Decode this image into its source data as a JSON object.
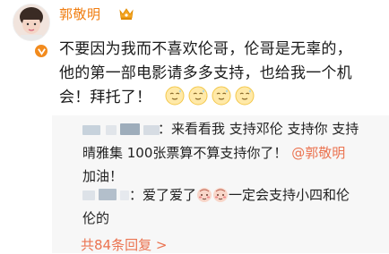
{
  "post": {
    "username": "郭敬明",
    "text": "不要因为我而不喜欢伦哥，伦哥是无辜的，\n他的第一部电影请多多支持，也给我一个机\n会！拜托了！",
    "emoji_count": 4,
    "emoji_icon": "sweat-smile-face-icon"
  },
  "replies": {
    "reply1_line1": "：来看看我 支持邓伦 支持你 支持",
    "reply1_line2": "晴雅集 100张票算不算支持你了！",
    "reply1_mention": "@郭敬明",
    "reply1_line3": "加油！",
    "reply2_line1a": "：爱了爱了",
    "reply2_line1b": "一定会支持小四和伦",
    "reply2_line2": "伦的",
    "more_link": "共84条回复 >"
  },
  "colors": {
    "username": "#f07d10",
    "link": "#eb7350",
    "reply_bg": "#f7f7f7"
  }
}
